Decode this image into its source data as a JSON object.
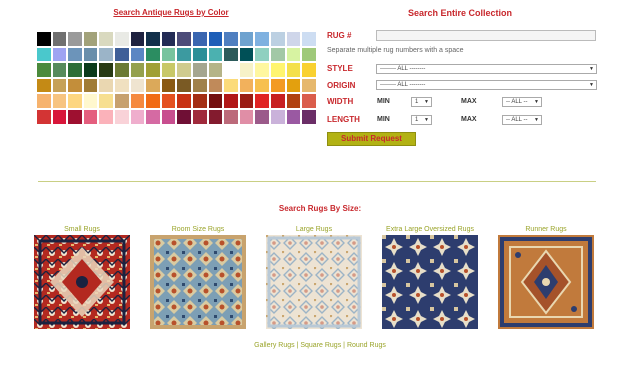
{
  "colors": {
    "heading_red": "#c8282d",
    "accent_olive": "#9aa42a",
    "button_olive": "#b2b214",
    "swatches": [
      "#000000",
      "#707070",
      "#9a9a9a",
      "#a2a27a",
      "#d9d9bf",
      "#e9eae5",
      "#1e2240",
      "#12304a",
      "#232c56",
      "#4c4b79",
      "#3a66b0",
      "#1e5fb8",
      "#4f7fc0",
      "#6ea2cf",
      "#7fb1e0",
      "#bcd0e2",
      "#cfd6ea",
      "#cdddf2",
      "#4ac8cc",
      "#9ea3f2",
      "#6c94ba",
      "#6a8fab",
      "#9bb4c8",
      "#3f5f98",
      "#5b86c3",
      "#2b8d61",
      "#78c39e",
      "#3c9aa0",
      "#2b8f98",
      "#4bb1b0",
      "#2c5b5b",
      "#005057",
      "#8fd0c0",
      "#a2c8a6",
      "#d7f3a2",
      "#9fc97a",
      "#4b8a3c",
      "#578b5c",
      "#2d6e38",
      "#0b3b1a",
      "#283a14",
      "#6b7a33",
      "#95a14e",
      "#a0a035",
      "#c8c868",
      "#cfcb8e",
      "#a5a68f",
      "#b5b487",
      "#ffffff",
      "#f7f2c8",
      "#fff79f",
      "#fff56f",
      "#f4e04a",
      "#f9d130",
      "#c48a15",
      "#c6a158",
      "#c38e3a",
      "#a07c36",
      "#ead7b1",
      "#f0e0c0",
      "#efe4d0",
      "#dba95a",
      "#8a5a14",
      "#7a5a24",
      "#a0814a",
      "#c08a5a",
      "#fbdb7a",
      "#f2b15c",
      "#f7c04e",
      "#f39a22",
      "#e3a00e",
      "#e6b86d",
      "#f6b36e",
      "#f7c480",
      "#fdd680",
      "#fff8ce",
      "#f7df90",
      "#c7a16e",
      "#f58a40",
      "#f16b14",
      "#e45120",
      "#c83214",
      "#a42e14",
      "#740e0e",
      "#b11717",
      "#9a1c14",
      "#e02424",
      "#c82020",
      "#b14210",
      "#da5d4b",
      "#d33434",
      "#d8163a",
      "#9e1030",
      "#e45e7e",
      "#fbb2ba",
      "#f9d2d8",
      "#efaecd",
      "#d56aa3",
      "#c84e8f",
      "#6f0f35",
      "#a02a3c",
      "#831b2e",
      "#bc6a7a",
      "#e08ea6",
      "#9b5a8a",
      "#cab2da",
      "#9a59a2",
      "#6b2e67"
    ]
  },
  "header": {
    "color_search_link": "Search Antique Rugs by Color",
    "collection_title": "Search Entire Collection"
  },
  "form": {
    "rug_label": "RUG #",
    "rug_value": "",
    "hint": "Separate multiple rug numbers with a space",
    "style_label": "STYLE",
    "style_value": "-------- ALL --------",
    "origin_label": "ORIGIN",
    "origin_value": "-------- ALL --------",
    "width_label": "WIDTH",
    "length_label": "LENGTH",
    "min_label": "MIN",
    "max_label": "MAX",
    "width_min_value": "1",
    "width_max_value": "-- ALL --",
    "length_min_value": "1",
    "length_max_value": "-- ALL --",
    "submit_label": "Submit Request"
  },
  "size_section": {
    "title": "Search Rugs By Size:",
    "categories": [
      {
        "label": "Small Rugs"
      },
      {
        "label": "Room Size Rugs"
      },
      {
        "label": "Large Rugs"
      },
      {
        "label": "Extra Large Oversized Rugs"
      },
      {
        "label": "Runner Rugs"
      }
    ]
  },
  "footer": {
    "links": [
      "Gallery Rugs",
      "Square Rugs",
      "Round Rugs"
    ],
    "separator": "|"
  }
}
